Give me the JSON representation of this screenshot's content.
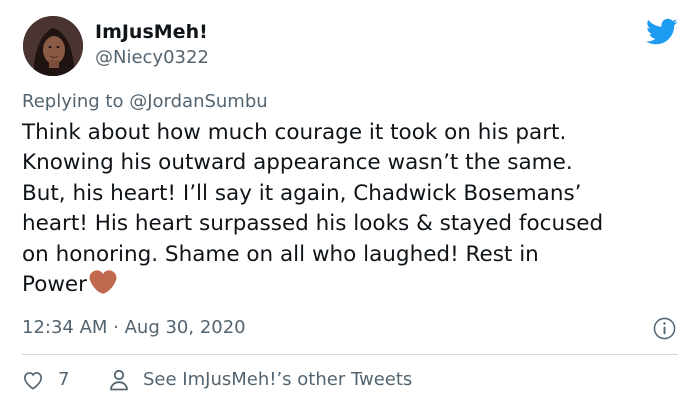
{
  "author": {
    "display_name": "ImJusMeh!",
    "handle": "@Niecy0322",
    "avatar": "profile-photo"
  },
  "reply": {
    "prefix": "Replying to ",
    "mention": "@JordanSumbu"
  },
  "tweet": {
    "text": "Think about how much courage it took on his part.\nKnowing his outward appearance wasn’t the same.\nBut, his heart! I’ll say it again, Chadwick Bosemans’\nheart! His heart surpassed his looks & stayed focused\non honoring. Shame on all who laughed! Rest in\nPower",
    "emoji": "brown-heart"
  },
  "meta": {
    "timestamp": "12:34 AM · Aug 30, 2020"
  },
  "actions": {
    "like_count": "7",
    "see_tweets_label": "See ImJusMeh!’s other Tweets"
  },
  "icons": {
    "brand": "twitter-bird-icon",
    "info": "info-icon",
    "like": "heart-outline-icon",
    "profile": "person-outline-icon"
  },
  "colors": {
    "twitter_blue": "#1d9bf0",
    "secondary_text": "#536471",
    "brown_heart": "#c1694f"
  }
}
